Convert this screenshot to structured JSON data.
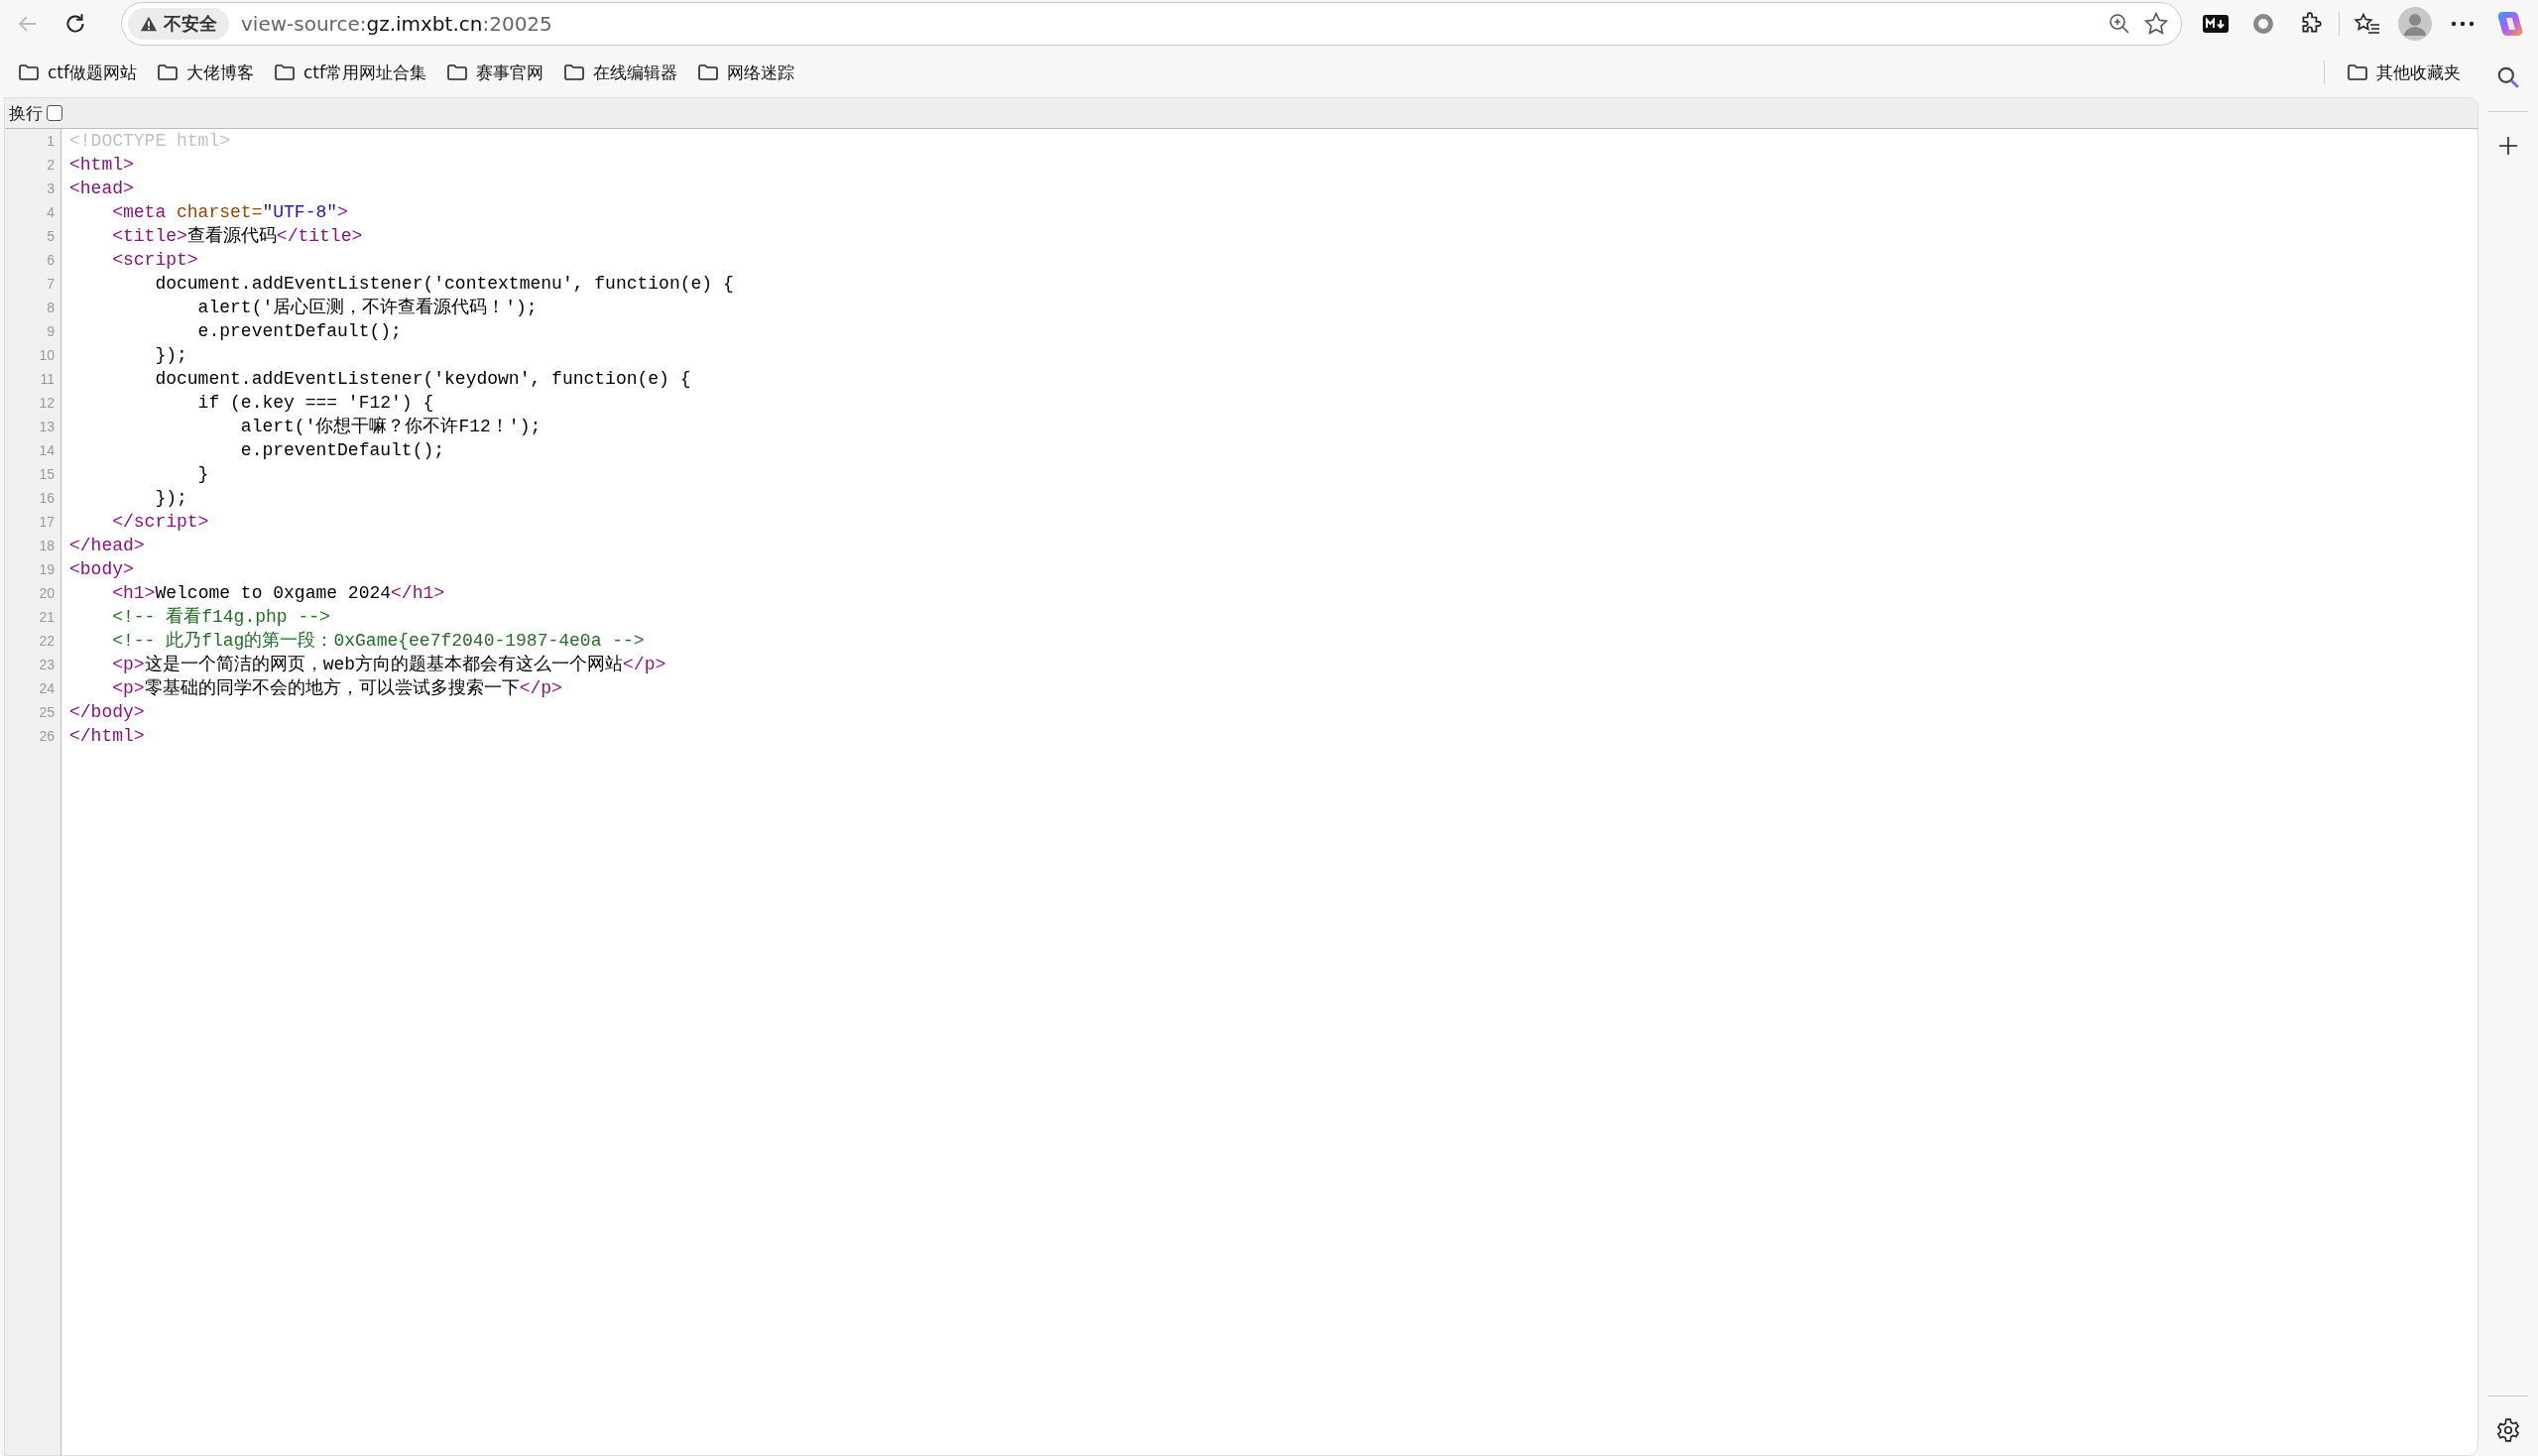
{
  "toolbar": {
    "security_label": "不安全",
    "url": {
      "scheme": "view-source:",
      "host": "gz.imxbt.cn",
      "port": ":20025"
    }
  },
  "bookmarks": [
    {
      "label": "ctf做题网站"
    },
    {
      "label": "大佬博客"
    },
    {
      "label": "ctf常用网址合集"
    },
    {
      "label": "赛事官网"
    },
    {
      "label": "在线编辑器"
    },
    {
      "label": "网络迷踪"
    }
  ],
  "other_bookmarks": {
    "label": "其他收藏夹"
  },
  "wrap_toggle": {
    "label": "换行",
    "checked": false
  },
  "source_lines": [
    {
      "number": "1",
      "tokens": [
        {
          "kind": "doctype",
          "text": "<!DOCTYPE html>"
        }
      ]
    },
    {
      "number": "2",
      "tokens": [
        {
          "kind": "tag",
          "text": "<html>"
        }
      ]
    },
    {
      "number": "3",
      "tokens": [
        {
          "kind": "tag",
          "text": "<head>"
        }
      ]
    },
    {
      "number": "4",
      "tokens": [
        {
          "kind": "tag",
          "text": "    <meta"
        },
        {
          "kind": "attr",
          "text": " charset="
        },
        {
          "kind": "value",
          "text": "\"UTF-8\""
        },
        {
          "kind": "tag",
          "text": ">"
        }
      ]
    },
    {
      "number": "5",
      "tokens": [
        {
          "kind": "tag",
          "text": "    <title>"
        },
        {
          "kind": "text",
          "text": "查看源代码"
        },
        {
          "kind": "tag",
          "text": "</title>"
        }
      ]
    },
    {
      "number": "6",
      "tokens": [
        {
          "kind": "tag",
          "text": "    <script>"
        }
      ]
    },
    {
      "number": "7",
      "tokens": [
        {
          "kind": "text",
          "text": "        document.addEventListener('contextmenu', function(e) {"
        }
      ]
    },
    {
      "number": "8",
      "tokens": [
        {
          "kind": "text",
          "text": "            alert('居心叵测，不许查看源代码！');"
        }
      ]
    },
    {
      "number": "9",
      "tokens": [
        {
          "kind": "text",
          "text": "            e.preventDefault();"
        }
      ]
    },
    {
      "number": "10",
      "tokens": [
        {
          "kind": "text",
          "text": "        });"
        }
      ]
    },
    {
      "number": "11",
      "tokens": [
        {
          "kind": "text",
          "text": "        document.addEventListener('keydown', function(e) {"
        }
      ]
    },
    {
      "number": "12",
      "tokens": [
        {
          "kind": "text",
          "text": "            if (e.key === 'F12') {"
        }
      ]
    },
    {
      "number": "13",
      "tokens": [
        {
          "kind": "text",
          "text": "                alert('你想干嘛？你不许F12！');"
        }
      ]
    },
    {
      "number": "14",
      "tokens": [
        {
          "kind": "text",
          "text": "                e.preventDefault();"
        }
      ]
    },
    {
      "number": "15",
      "tokens": [
        {
          "kind": "text",
          "text": "            }"
        }
      ]
    },
    {
      "number": "16",
      "tokens": [
        {
          "kind": "text",
          "text": "        });"
        }
      ]
    },
    {
      "number": "17",
      "tokens": [
        {
          "kind": "tag",
          "text": "    </script>"
        }
      ]
    },
    {
      "number": "18",
      "tokens": [
        {
          "kind": "tag",
          "text": "</head>"
        }
      ]
    },
    {
      "number": "19",
      "tokens": [
        {
          "kind": "tag",
          "text": "<body>"
        }
      ]
    },
    {
      "number": "20",
      "tokens": [
        {
          "kind": "tag",
          "text": "    <h1>"
        },
        {
          "kind": "text",
          "text": "Welcome to 0xgame 2024"
        },
        {
          "kind": "tag",
          "text": "</h1>"
        }
      ]
    },
    {
      "number": "21",
      "tokens": [
        {
          "kind": "comment",
          "text": "    <!-- 看看f14g.php -->"
        }
      ]
    },
    {
      "number": "22",
      "tokens": [
        {
          "kind": "comment",
          "text": "    <!-- 此乃flag的第一段：0xGame{ee7f2040-1987-4e0a -->"
        }
      ]
    },
    {
      "number": "23",
      "tokens": [
        {
          "kind": "tag",
          "text": "    <p>"
        },
        {
          "kind": "text",
          "text": "这是一个简洁的网页，web方向的题基本都会有这么一个网站"
        },
        {
          "kind": "tag",
          "text": "</p>"
        }
      ]
    },
    {
      "number": "24",
      "tokens": [
        {
          "kind": "tag",
          "text": "    <p>"
        },
        {
          "kind": "text",
          "text": "零基础的同学不会的地方，可以尝试多搜索一下"
        },
        {
          "kind": "tag",
          "text": "</p>"
        }
      ]
    },
    {
      "number": "25",
      "tokens": [
        {
          "kind": "tag",
          "text": "</body>"
        }
      ]
    },
    {
      "number": "26",
      "tokens": [
        {
          "kind": "tag",
          "text": "</html>"
        }
      ]
    }
  ]
}
